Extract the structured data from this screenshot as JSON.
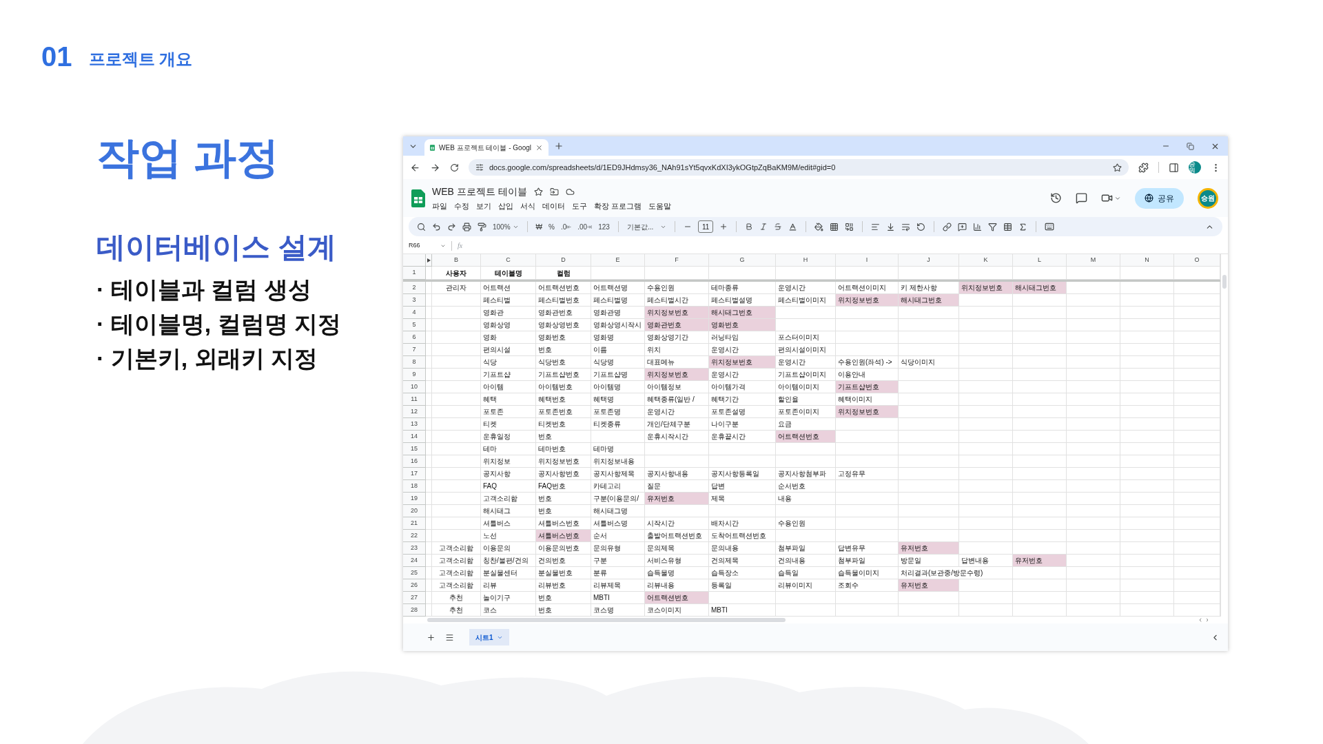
{
  "slide": {
    "section_number": "01",
    "section_title": "프로젝트 개요",
    "title": "작업 과정",
    "subtitle": "데이터베이스 설계",
    "bullets": [
      "· 테이블과 컬럼 생성",
      "· 테이블명, 컬럼명 지정",
      "· 기본키, 외래키 지정"
    ]
  },
  "browser": {
    "tab_title": "WEB 프로젝트 테이블 - Googl",
    "url": "docs.google.com/spreadsheets/d/1ED9JHdmsy36_NAh91sYt5qvxKdXI3ykOGtpZqBaKM9M/edit#gid=0",
    "profile": "승원"
  },
  "sheet": {
    "title": "WEB 프로젝트 테이블",
    "menu": [
      "파일",
      "수정",
      "보기",
      "삽입",
      "서식",
      "데이터",
      "도구",
      "확장 프로그램",
      "도움말"
    ],
    "share_label": "공유",
    "avatar": "승원",
    "toolbar": {
      "zoom": "100%",
      "currency": "₩",
      "percent": "%",
      "decimal_decrease": ".0",
      "decimal_increase": ".00",
      "number_format": "123",
      "font": "기본값...",
      "font_size": "11"
    },
    "cell_ref": "R66",
    "formula_label": "fx",
    "columns": [
      "B",
      "C",
      "D",
      "E",
      "F",
      "G",
      "H",
      "I",
      "J",
      "K",
      "L",
      "M",
      "N",
      "O"
    ],
    "rows": [
      {
        "number": "1",
        "kind": "header",
        "cells": [
          {
            "text": "사용자",
            "highlighted": false
          },
          {
            "text": "테이블명",
            "highlighted": false
          },
          {
            "text": "컬럼",
            "highlighted": false
          }
        ]
      },
      {
        "number": "2",
        "kind": "data",
        "cells": [
          {
            "text": "관리자",
            "highlighted": false
          },
          {
            "text": "어트랙션",
            "highlighted": false
          },
          {
            "text": "어트랙션번호",
            "highlighted": false
          },
          {
            "text": "어트랙션명",
            "highlighted": false
          },
          {
            "text": "수용인원",
            "highlighted": false
          },
          {
            "text": "테마종류",
            "highlighted": false
          },
          {
            "text": "운영시간",
            "highlighted": false
          },
          {
            "text": "어트랙션이미지",
            "highlighted": false
          },
          {
            "text": "키 제한사항",
            "highlighted": false
          },
          {
            "text": "위치정보번호",
            "highlighted": true
          },
          {
            "text": "해시태그번호",
            "highlighted": true
          }
        ]
      },
      {
        "number": "3",
        "kind": "data",
        "cells": [
          null,
          {
            "text": "페스티벌",
            "highlighted": false
          },
          {
            "text": "페스티벌번호",
            "highlighted": false
          },
          {
            "text": "페스티벌명",
            "highlighted": false
          },
          {
            "text": "페스티벌시간",
            "highlighted": false
          },
          {
            "text": "페스티벌설명",
            "highlighted": false
          },
          {
            "text": "페스티벌이미지",
            "highlighted": false
          },
          {
            "text": "위치정보번호",
            "highlighted": true
          },
          {
            "text": "해시태그번호",
            "highlighted": true
          }
        ]
      },
      {
        "number": "4",
        "kind": "data",
        "cells": [
          null,
          {
            "text": "영화관",
            "highlighted": false
          },
          {
            "text": "영화관번호",
            "highlighted": false
          },
          {
            "text": "영화관명",
            "highlighted": false
          },
          {
            "text": "위치정보번호",
            "highlighted": true
          },
          {
            "text": "해시태그번호",
            "highlighted": true
          }
        ]
      },
      {
        "number": "5",
        "kind": "data",
        "cells": [
          null,
          {
            "text": "영화상영",
            "highlighted": false
          },
          {
            "text": "영화상영번호",
            "highlighted": false
          },
          {
            "text": "영화상영시작시",
            "highlighted": false
          },
          {
            "text": "영화관번호",
            "highlighted": true
          },
          {
            "text": "영화번호",
            "highlighted": true
          }
        ]
      },
      {
        "number": "6",
        "kind": "data",
        "cells": [
          null,
          {
            "text": "영화",
            "highlighted": false
          },
          {
            "text": "영화번호",
            "highlighted": false
          },
          {
            "text": "영화명",
            "highlighted": false
          },
          {
            "text": "영화상영기간",
            "highlighted": false
          },
          {
            "text": "러닝타임",
            "highlighted": false
          },
          {
            "text": "포스터이미지",
            "highlighted": false
          }
        ]
      },
      {
        "number": "7",
        "kind": "data",
        "cells": [
          null,
          {
            "text": "편의시설",
            "highlighted": false
          },
          {
            "text": "번호",
            "highlighted": false
          },
          {
            "text": "이름",
            "highlighted": false
          },
          {
            "text": "위치",
            "highlighted": false
          },
          {
            "text": "운영시간",
            "highlighted": false
          },
          {
            "text": "편의시설이미지",
            "highlighted": false
          }
        ]
      },
      {
        "number": "8",
        "kind": "data",
        "cells": [
          null,
          {
            "text": "식당",
            "highlighted": false
          },
          {
            "text": "식당번호",
            "highlighted": false
          },
          {
            "text": "식당명",
            "highlighted": false
          },
          {
            "text": "대표메뉴",
            "highlighted": false
          },
          {
            "text": "위치정보번호",
            "highlighted": true
          },
          {
            "text": "운영시간",
            "highlighted": false
          },
          {
            "text": "수용인원(좌석) ->",
            "highlighted": false
          },
          {
            "text": "식당이미지",
            "highlighted": false
          }
        ]
      },
      {
        "number": "9",
        "kind": "data",
        "cells": [
          null,
          {
            "text": "기프트샵",
            "highlighted": false
          },
          {
            "text": "기프트샵번호",
            "highlighted": false
          },
          {
            "text": "기프트샵명",
            "highlighted": false
          },
          {
            "text": "위치정보번호",
            "highlighted": true
          },
          {
            "text": "운영시간",
            "highlighted": false
          },
          {
            "text": "기프트샵이미지",
            "highlighted": false
          },
          {
            "text": "이용안내",
            "highlighted": false
          }
        ]
      },
      {
        "number": "10",
        "kind": "data",
        "cells": [
          null,
          {
            "text": "아이템",
            "highlighted": false
          },
          {
            "text": "아이템번호",
            "highlighted": false
          },
          {
            "text": "아이템명",
            "highlighted": false
          },
          {
            "text": "아이템정보",
            "highlighted": false
          },
          {
            "text": "아이템가격",
            "highlighted": false
          },
          {
            "text": "아이템이미지",
            "highlighted": false
          },
          {
            "text": "기프트샵번호",
            "highlighted": true
          }
        ]
      },
      {
        "number": "11",
        "kind": "data",
        "cells": [
          null,
          {
            "text": "혜택",
            "highlighted": false
          },
          {
            "text": "혜택번호",
            "highlighted": false
          },
          {
            "text": "혜택명",
            "highlighted": false
          },
          {
            "text": "혜택종류(일반 /",
            "highlighted": false
          },
          {
            "text": "혜택기간",
            "highlighted": false
          },
          {
            "text": "할인율",
            "highlighted": false
          },
          {
            "text": "혜택이미지",
            "highlighted": false
          }
        ]
      },
      {
        "number": "12",
        "kind": "data",
        "cells": [
          null,
          {
            "text": "포토존",
            "highlighted": false
          },
          {
            "text": "포토존번호",
            "highlighted": false
          },
          {
            "text": "포토존명",
            "highlighted": false
          },
          {
            "text": "운영시간",
            "highlighted": false
          },
          {
            "text": "포토존설명",
            "highlighted": false
          },
          {
            "text": "포토존이미지",
            "highlighted": false
          },
          {
            "text": "위치정보번호",
            "highlighted": true
          }
        ]
      },
      {
        "number": "13",
        "kind": "data",
        "cells": [
          null,
          {
            "text": "티켓",
            "highlighted": false
          },
          {
            "text": "티켓번호",
            "highlighted": false
          },
          {
            "text": "티켓종류",
            "highlighted": false
          },
          {
            "text": "개인/단체구분",
            "highlighted": false
          },
          {
            "text": "나이구분",
            "highlighted": false
          },
          {
            "text": "요금",
            "highlighted": false
          }
        ]
      },
      {
        "number": "14",
        "kind": "data",
        "cells": [
          null,
          {
            "text": "운휴일정",
            "highlighted": false
          },
          {
            "text": "번호",
            "highlighted": false
          },
          null,
          {
            "text": "운휴시작시간",
            "highlighted": false
          },
          {
            "text": "운휴끝시간",
            "highlighted": false
          },
          {
            "text": "어트랙션번호",
            "highlighted": true
          }
        ]
      },
      {
        "number": "15",
        "kind": "data",
        "cells": [
          null,
          {
            "text": "테마",
            "highlighted": false
          },
          {
            "text": "테마번호",
            "highlighted": false
          },
          {
            "text": "테마명",
            "highlighted": false
          }
        ]
      },
      {
        "number": "16",
        "kind": "data",
        "cells": [
          null,
          {
            "text": "위치정보",
            "highlighted": false
          },
          {
            "text": "위치정보번호",
            "highlighted": false
          },
          {
            "text": "위치정보내용",
            "highlighted": false
          }
        ]
      },
      {
        "number": "17",
        "kind": "data",
        "cells": [
          null,
          {
            "text": "공지사항",
            "highlighted": false
          },
          {
            "text": "공지사항번호",
            "highlighted": false
          },
          {
            "text": "공지사항제목",
            "highlighted": false
          },
          {
            "text": "공지사항내용",
            "highlighted": false
          },
          {
            "text": "공지사항등록일",
            "highlighted": false
          },
          {
            "text": "공지사항첨부파",
            "highlighted": false
          },
          {
            "text": "고정유무",
            "highlighted": false
          }
        ]
      },
      {
        "number": "18",
        "kind": "data",
        "cells": [
          null,
          {
            "text": "FAQ",
            "highlighted": false
          },
          {
            "text": "FAQ번호",
            "highlighted": false
          },
          {
            "text": "카테고리",
            "highlighted": false
          },
          {
            "text": "질문",
            "highlighted": false
          },
          {
            "text": "답변",
            "highlighted": false
          },
          {
            "text": "순서번호",
            "highlighted": false
          }
        ]
      },
      {
        "number": "19",
        "kind": "data",
        "cells": [
          null,
          {
            "text": "고객소리함",
            "highlighted": false
          },
          {
            "text": "번호",
            "highlighted": false
          },
          {
            "text": "구분(이용문의/",
            "highlighted": false
          },
          {
            "text": "유저번호",
            "highlighted": true
          },
          {
            "text": "제목",
            "highlighted": false
          },
          {
            "text": "내용",
            "highlighted": false
          }
        ]
      },
      {
        "number": "20",
        "kind": "data",
        "cells": [
          null,
          {
            "text": "해시태그",
            "highlighted": false
          },
          {
            "text": "번호",
            "highlighted": false
          },
          {
            "text": "해시태그명",
            "highlighted": false
          }
        ]
      },
      {
        "number": "21",
        "kind": "data",
        "cells": [
          null,
          {
            "text": "셔틀버스",
            "highlighted": false
          },
          {
            "text": "셔틀버스번호",
            "highlighted": false
          },
          {
            "text": "셔틀버스명",
            "highlighted": false
          },
          {
            "text": "시작시간",
            "highlighted": false
          },
          {
            "text": "배차시간",
            "highlighted": false
          },
          {
            "text": "수용인원",
            "highlighted": false
          }
        ]
      },
      {
        "number": "22",
        "kind": "data",
        "cells": [
          null,
          {
            "text": "노선",
            "highlighted": false
          },
          {
            "text": "셔틀버스번호",
            "highlighted": true
          },
          {
            "text": "순서",
            "highlighted": false
          },
          {
            "text": "출발어트랙션번호",
            "highlighted": false
          },
          {
            "text": "도착어트랙션번호",
            "highlighted": false
          }
        ]
      },
      {
        "number": "23",
        "kind": "data",
        "cells": [
          {
            "text": "고객소리함",
            "highlighted": false
          },
          {
            "text": "이용문의",
            "highlighted": false
          },
          {
            "text": "이용문의번호",
            "highlighted": false
          },
          {
            "text": "문의유형",
            "highlighted": false
          },
          {
            "text": "문의제목",
            "highlighted": false
          },
          {
            "text": "문의내용",
            "highlighted": false
          },
          {
            "text": "첨부파일",
            "highlighted": false
          },
          {
            "text": "답변유무",
            "highlighted": false
          },
          {
            "text": "유저번호",
            "highlighted": true
          }
        ]
      },
      {
        "number": "24",
        "kind": "data",
        "cells": [
          {
            "text": "고객소리함",
            "highlighted": false
          },
          {
            "text": "칭찬/불편/건의",
            "highlighted": false
          },
          {
            "text": "건의번호",
            "highlighted": false
          },
          {
            "text": "구분",
            "highlighted": false
          },
          {
            "text": "서비스유형",
            "highlighted": false
          },
          {
            "text": "건의제목",
            "highlighted": false
          },
          {
            "text": "건의내용",
            "highlighted": false
          },
          {
            "text": "첨부파일",
            "highlighted": false
          },
          {
            "text": "방문일",
            "highlighted": false
          },
          {
            "text": "답변내용",
            "highlighted": false
          },
          {
            "text": "유저번호",
            "highlighted": true
          }
        ]
      },
      {
        "number": "25",
        "kind": "data",
        "cells": [
          {
            "text": "고객소리함",
            "highlighted": false
          },
          {
            "text": "분실물센터",
            "highlighted": false
          },
          {
            "text": "분실물번호",
            "highlighted": false
          },
          {
            "text": "분류",
            "highlighted": false
          },
          {
            "text": "습득물명",
            "highlighted": false
          },
          {
            "text": "습득장소",
            "highlighted": false
          },
          {
            "text": "습득일",
            "highlighted": false
          },
          {
            "text": "습득물이미지",
            "highlighted": false
          },
          {
            "text": "처리결과(보관중/방문수령)",
            "highlighted": false
          }
        ]
      },
      {
        "number": "26",
        "kind": "data",
        "cells": [
          {
            "text": "고객소리함",
            "highlighted": false
          },
          {
            "text": "리뷰",
            "highlighted": false
          },
          {
            "text": "리뷰번호",
            "highlighted": false
          },
          {
            "text": "리뷰제목",
            "highlighted": false
          },
          {
            "text": "리뷰내용",
            "highlighted": false
          },
          {
            "text": "등록일",
            "highlighted": false
          },
          {
            "text": "리뷰이미지",
            "highlighted": false
          },
          {
            "text": "조회수",
            "highlighted": false
          },
          {
            "text": "유저번호",
            "highlighted": true
          }
        ]
      },
      {
        "number": "27",
        "kind": "data",
        "cells": [
          {
            "text": "추천",
            "highlighted": false
          },
          {
            "text": "놀이기구",
            "highlighted": false
          },
          {
            "text": "번호",
            "highlighted": false
          },
          {
            "text": "MBTI",
            "highlighted": false
          },
          {
            "text": "어트랙션번호",
            "highlighted": true
          }
        ]
      },
      {
        "number": "28",
        "kind": "data",
        "cells": [
          {
            "text": "추천",
            "highlighted": false
          },
          {
            "text": "코스",
            "highlighted": false
          },
          {
            "text": "번호",
            "highlighted": false
          },
          {
            "text": "코스명",
            "highlighted": false
          },
          {
            "text": "코스이미지",
            "highlighted": false
          },
          {
            "text": "MBTI",
            "highlighted": false
          }
        ]
      }
    ],
    "sheet_tabs": [
      {
        "label": "시트1",
        "selected": true
      }
    ]
  }
}
